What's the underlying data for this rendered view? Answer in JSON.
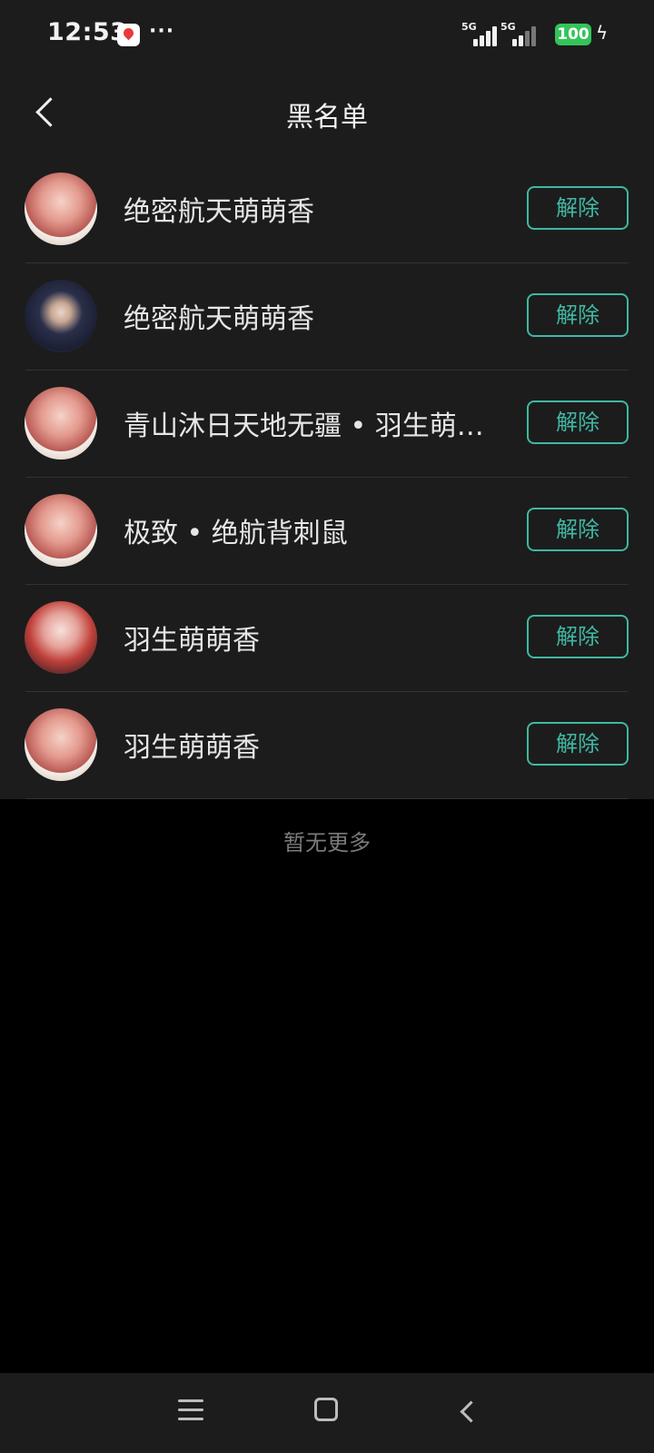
{
  "status_bar": {
    "time": "12:53",
    "more": "···",
    "signal_1": "5G",
    "signal_2": "5G",
    "battery": "100",
    "app_icon": "map-pin-icon",
    "charging_icon": "lightning-icon"
  },
  "header": {
    "title": "黑名单",
    "back_icon": "chevron-left-icon"
  },
  "blacklist": {
    "unblock_label": "解除",
    "items": [
      {
        "name": "绝密航天萌萌香",
        "avatar_palette": "pink"
      },
      {
        "name": "绝密航天萌萌香",
        "avatar_palette": "navy"
      },
      {
        "name": "青山沐日天地无疆 • 羽生萌萌香",
        "avatar_palette": "pink"
      },
      {
        "name": "极致 • 绝航背刺鼠",
        "avatar_palette": "pink"
      },
      {
        "name": "羽生萌萌香",
        "avatar_palette": "red"
      },
      {
        "name": "羽生萌萌香",
        "avatar_palette": "pink"
      }
    ]
  },
  "footer": {
    "end_text": "暂无更多"
  },
  "nav_bar": {
    "icons": [
      "menu-icon",
      "home-square-icon",
      "back-arrow-icon"
    ]
  },
  "colors": {
    "accent": "#3fb8a3",
    "panel_bg": "#1c1c1c",
    "page_bg": "#000000",
    "battery": "#33c45a"
  }
}
